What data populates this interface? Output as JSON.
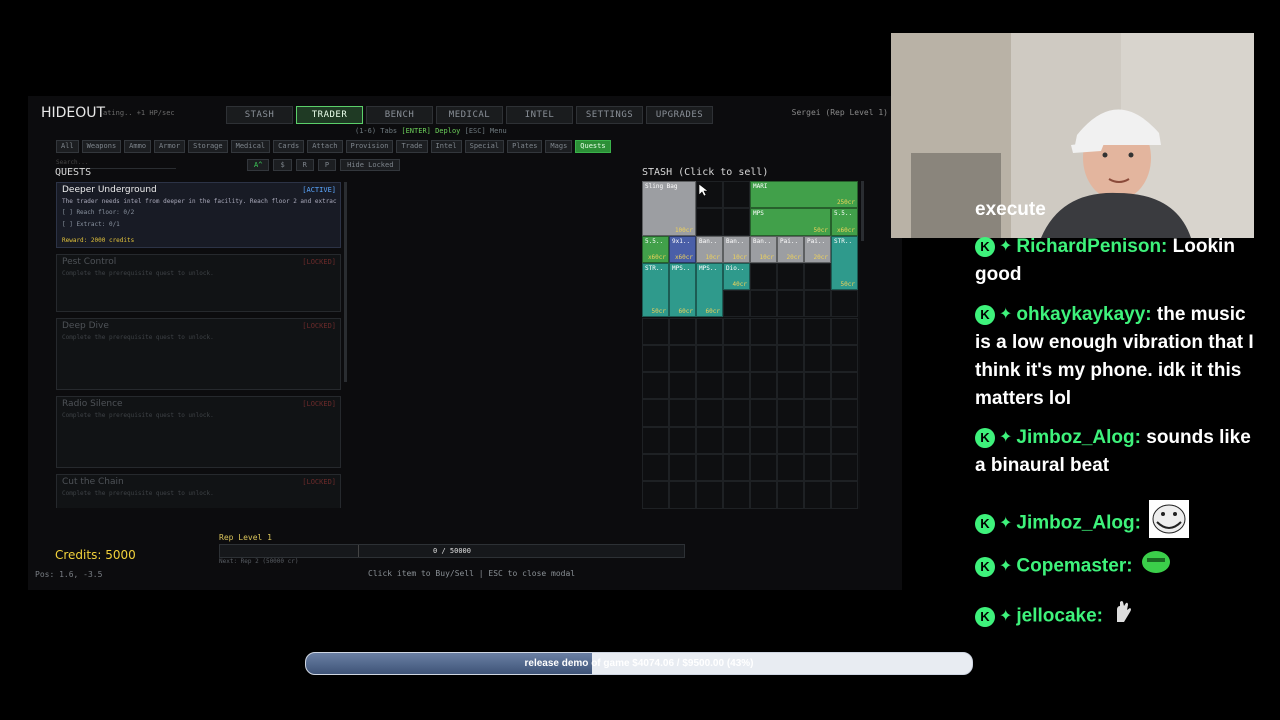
{
  "game": {
    "logo": "HIDEOUT",
    "logo_sub": "ating.. +1 HP/sec",
    "nav_tabs": [
      {
        "label": "STASH"
      },
      {
        "label": "TRADER",
        "active": true
      },
      {
        "label": "BENCH"
      },
      {
        "label": "MEDICAL"
      },
      {
        "label": "INTEL"
      },
      {
        "label": "SETTINGS"
      },
      {
        "label": "UPGRADES"
      }
    ],
    "player": "Sergei (Rep Level 1)",
    "hint_top_prefix": "(1-6) Tabs",
    "hint_top_action": "[ENTER] Deploy",
    "hint_top_suffix": "[ESC] Menu",
    "filters": [
      {
        "label": "All"
      },
      {
        "label": "Weapons"
      },
      {
        "label": "Ammo"
      },
      {
        "label": "Armor"
      },
      {
        "label": "Storage"
      },
      {
        "label": "Medical"
      },
      {
        "label": "Cards"
      },
      {
        "label": "Attach"
      },
      {
        "label": "Provision"
      },
      {
        "label": "Trade"
      },
      {
        "label": "Intel"
      },
      {
        "label": "Special"
      },
      {
        "label": "Plates"
      },
      {
        "label": "Mags"
      },
      {
        "label": "Quests",
        "active": true
      }
    ],
    "search_placeholder": "Search...",
    "sorts": [
      {
        "label": "A^",
        "active": true
      },
      {
        "label": "$"
      },
      {
        "label": "R"
      },
      {
        "label": "P"
      },
      {
        "label": "Hide Locked"
      }
    ],
    "quests_title": "QUESTS",
    "quests": [
      {
        "name": "Deeper Underground",
        "status": "[ACTIVE]",
        "desc": "The trader needs intel from deeper in the facility. Reach floor 2 and extract a",
        "objectives": [
          "[ ]   Reach floor: 0/2",
          "[ ]   Extract: 0/1"
        ],
        "reward": "Reward: 2000 credits",
        "active": true
      },
      {
        "name": "Pest Control",
        "status": "[LOCKED]",
        "desc": "Complete the prerequisite quest to unlock."
      },
      {
        "name": "Deep Dive",
        "status": "[LOCKED]",
        "desc": "Complete the prerequisite quest to unlock."
      },
      {
        "name": "Radio Silence",
        "status": "[LOCKED]",
        "desc": "Complete the prerequisite quest to unlock."
      },
      {
        "name": "Cut the Chain",
        "status": "[LOCKED]",
        "desc": "Complete the prerequisite quest to unlock."
      }
    ],
    "stash_title": "STASH (Click to sell)",
    "stash_items": [
      {
        "name": "Sling Bag",
        "price": "100cr",
        "color": "#9c9ea2",
        "c": 0,
        "r": 0,
        "w": 2,
        "h": 2
      },
      {
        "name": "MARI",
        "price": "250cr",
        "color": "#41a04a",
        "c": 4,
        "r": 0,
        "w": 4,
        "h": 1
      },
      {
        "name": "MPS",
        "price": "50cr",
        "color": "#41a04a",
        "c": 4,
        "r": 1,
        "w": 3,
        "h": 1
      },
      {
        "name": "5.5..",
        "price": "x60cr",
        "color": "#41a04a",
        "c": 7,
        "r": 1,
        "w": 1,
        "h": 1
      },
      {
        "name": "5.5..",
        "price": "x60cr",
        "color": "#41a04a",
        "c": 0,
        "r": 2,
        "w": 1,
        "h": 1
      },
      {
        "name": "9x1..",
        "price": "x60cr",
        "color": "#4a5fa8",
        "c": 1,
        "r": 2,
        "w": 1,
        "h": 1
      },
      {
        "name": "Ban..",
        "price": "10cr",
        "color": "#9c9ea2",
        "c": 2,
        "r": 2,
        "w": 1,
        "h": 1
      },
      {
        "name": "Ban..",
        "price": "10cr",
        "color": "#9c9ea2",
        "c": 3,
        "r": 2,
        "w": 1,
        "h": 1
      },
      {
        "name": "Ban..",
        "price": "10cr",
        "color": "#9c9ea2",
        "c": 4,
        "r": 2,
        "w": 1,
        "h": 1
      },
      {
        "name": "Pai..",
        "price": "20cr",
        "color": "#9c9ea2",
        "c": 5,
        "r": 2,
        "w": 1,
        "h": 1
      },
      {
        "name": "Pai..",
        "price": "20cr",
        "color": "#9c9ea2",
        "c": 6,
        "r": 2,
        "w": 1,
        "h": 1
      },
      {
        "name": "STR..",
        "price": "50cr",
        "color": "#2f9a8c",
        "c": 7,
        "r": 2,
        "w": 1,
        "h": 2
      },
      {
        "name": "STR..",
        "price": "50cr",
        "color": "#2f9a8c",
        "c": 0,
        "r": 3,
        "w": 1,
        "h": 2
      },
      {
        "name": "MPS..",
        "price": "60cr",
        "color": "#2f9a8c",
        "c": 1,
        "r": 3,
        "w": 1,
        "h": 2
      },
      {
        "name": "MPS..",
        "price": "60cr",
        "color": "#2f9a8c",
        "c": 2,
        "r": 3,
        "w": 1,
        "h": 2
      },
      {
        "name": "Dio..",
        "price": "40cr",
        "color": "#2f9a8c",
        "c": 3,
        "r": 3,
        "w": 1,
        "h": 1
      }
    ],
    "credits": "Credits: 5000",
    "pos": "Pos: 1.6, -3.5",
    "rep_label": "Rep Level 1",
    "rep_text": "0 / 50000",
    "rep_progress": 0.0,
    "rep_next": "Next: Rep 2 (50000 cr)",
    "bottom_hint": "Click item to Buy/Sell  |  ESC to close modal"
  },
  "chat": {
    "partial": "execute",
    "messages": [
      {
        "user": "RichardPenison:",
        "text": "Lookin good"
      },
      {
        "user": "ohkaykaykayy:",
        "text": "the music is a low enough vibration that I think it's my phone. idk it this matters lol"
      },
      {
        "user": "Jimboz_Alog:",
        "text": "sounds like a binaural beat"
      },
      {
        "user": "Jimboz_Alog:",
        "text": "",
        "emote": "trollface-emote"
      },
      {
        "user": "Copemaster:",
        "text": "",
        "emote": "green-blob-emote"
      },
      {
        "user": "jellocake:",
        "text": "",
        "emote": "hand-emote"
      }
    ]
  },
  "goal": {
    "prefix": "release demo",
    "text": "release demo of game $4074.06 / $9500.00 (43%)",
    "progress": 0.43
  }
}
